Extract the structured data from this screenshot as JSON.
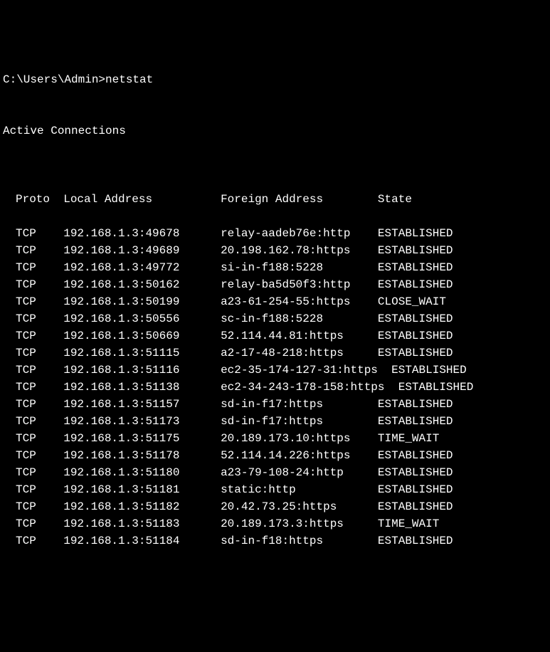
{
  "prompt": "C:\\Users\\Admin>netstat",
  "section_title": "Active Connections",
  "headers": {
    "proto": "Proto",
    "local": "Local Address",
    "foreign": "Foreign Address",
    "state": "State"
  },
  "connections": [
    {
      "proto": "TCP",
      "local": "192.168.1.3:49678",
      "foreign": "relay-aadeb76e:http",
      "state": "ESTABLISHED"
    },
    {
      "proto": "TCP",
      "local": "192.168.1.3:49689",
      "foreign": "20.198.162.78:https",
      "state": "ESTABLISHED"
    },
    {
      "proto": "TCP",
      "local": "192.168.1.3:49772",
      "foreign": "si-in-f188:5228",
      "state": "ESTABLISHED"
    },
    {
      "proto": "TCP",
      "local": "192.168.1.3:50162",
      "foreign": "relay-ba5d50f3:http",
      "state": "ESTABLISHED"
    },
    {
      "proto": "TCP",
      "local": "192.168.1.3:50199",
      "foreign": "a23-61-254-55:https",
      "state": "CLOSE_WAIT"
    },
    {
      "proto": "TCP",
      "local": "192.168.1.3:50556",
      "foreign": "sc-in-f188:5228",
      "state": "ESTABLISHED"
    },
    {
      "proto": "TCP",
      "local": "192.168.1.3:50669",
      "foreign": "52.114.44.81:https",
      "state": "ESTABLISHED"
    },
    {
      "proto": "TCP",
      "local": "192.168.1.3:51115",
      "foreign": "a2-17-48-218:https",
      "state": "ESTABLISHED"
    },
    {
      "proto": "TCP",
      "local": "192.168.1.3:51116",
      "foreign": "ec2-35-174-127-31:https",
      "state": " ESTABLISHED"
    },
    {
      "proto": "TCP",
      "local": "192.168.1.3:51138",
      "foreign": "ec2-34-243-178-158:https",
      "state": " ESTABLISHED"
    },
    {
      "proto": "TCP",
      "local": "192.168.1.3:51157",
      "foreign": "sd-in-f17:https",
      "state": "ESTABLISHED"
    },
    {
      "proto": "TCP",
      "local": "192.168.1.3:51173",
      "foreign": "sd-in-f17:https",
      "state": "ESTABLISHED"
    },
    {
      "proto": "TCP",
      "local": "192.168.1.3:51175",
      "foreign": "20.189.173.10:https",
      "state": "TIME_WAIT"
    },
    {
      "proto": "TCP",
      "local": "192.168.1.3:51178",
      "foreign": "52.114.14.226:https",
      "state": "ESTABLISHED"
    },
    {
      "proto": "TCP",
      "local": "192.168.1.3:51180",
      "foreign": "a23-79-108-24:http",
      "state": "ESTABLISHED"
    },
    {
      "proto": "TCP",
      "local": "192.168.1.3:51181",
      "foreign": "static:http",
      "state": "ESTABLISHED"
    },
    {
      "proto": "TCP",
      "local": "192.168.1.3:51182",
      "foreign": "20.42.73.25:https",
      "state": "ESTABLISHED"
    },
    {
      "proto": "TCP",
      "local": "192.168.1.3:51183",
      "foreign": "20.189.173.3:https",
      "state": "TIME_WAIT"
    },
    {
      "proto": "TCP",
      "local": "192.168.1.3:51184",
      "foreign": "sd-in-f18:https",
      "state": "ESTABLISHED"
    }
  ]
}
